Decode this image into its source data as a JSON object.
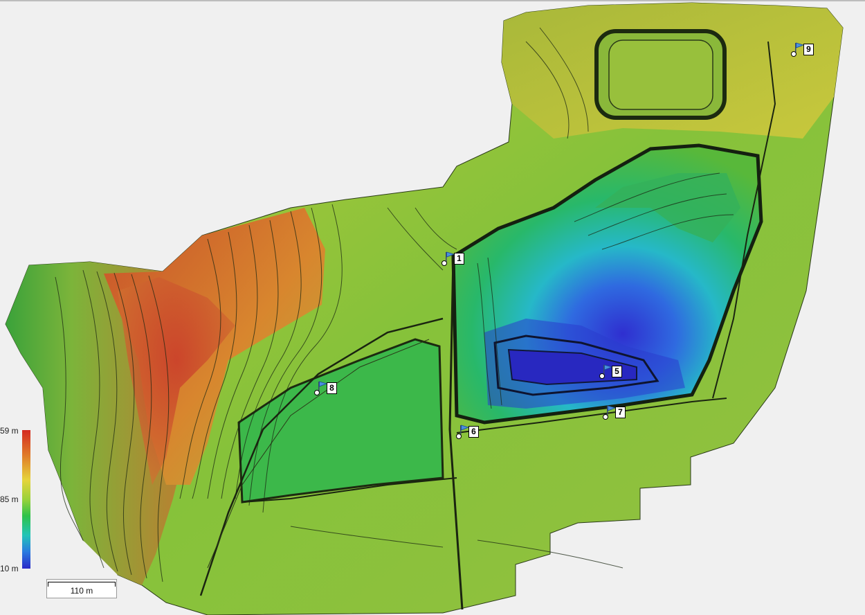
{
  "legend": {
    "top_label": "59 m",
    "mid_label": "85 m",
    "bottom_label": "10 m"
  },
  "scale": {
    "label": "110 m"
  },
  "markers": [
    {
      "id": "1",
      "label": "1"
    },
    {
      "id": "5",
      "label": "5"
    },
    {
      "id": "6",
      "label": "6"
    },
    {
      "id": "7",
      "label": "7"
    },
    {
      "id": "8",
      "label": "8"
    },
    {
      "id": "9",
      "label": "9"
    }
  ],
  "colors": {
    "high": "#d42a20",
    "upper": "#e07a28",
    "middle": "#9ad23a",
    "lower": "#2ec24a",
    "deep": "#22c4b8",
    "bottom": "#2b2ac8"
  }
}
